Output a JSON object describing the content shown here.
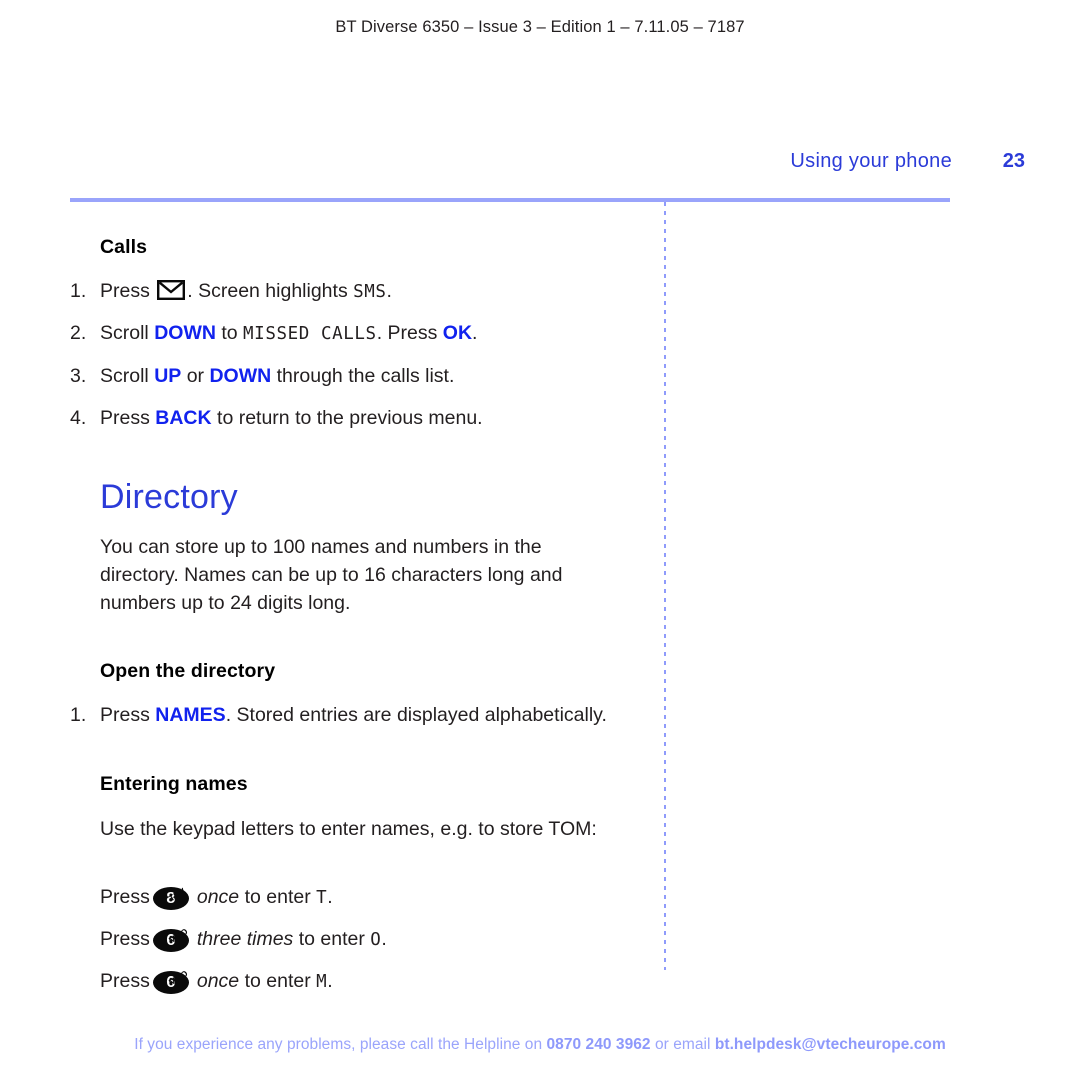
{
  "document": {
    "header_line": "BT Diverse 6350 – Issue 3 – Edition 1 – 7.11.05 – 7187"
  },
  "running_head": {
    "title": "Using your phone",
    "page_number": "23"
  },
  "colors": {
    "accent_blue": "#2b3bd8",
    "keyword_blue": "#1122ee",
    "rule_blue": "#9aa4fb",
    "footer_blue": "#9aa4fb",
    "body_black": "#231f20"
  },
  "sections": {
    "calls": {
      "heading": "Calls",
      "steps": [
        {
          "number": "1.",
          "before_icon": "Press ",
          "icon": "envelope-icon",
          "after_icon": ". Screen highlights ",
          "lcd": "SMS",
          "tail": "."
        },
        {
          "number": "2.",
          "part1": "Scroll ",
          "kw1": "DOWN",
          "part2": " to ",
          "lcd": "MISSED CALLS",
          "part3": ". Press ",
          "kw2": "OK",
          "tail": "."
        },
        {
          "number": "3.",
          "part1": "Scroll ",
          "kw1": "UP",
          "part2": " or ",
          "kw2": "DOWN",
          "part3": " through the calls list."
        },
        {
          "number": "4.",
          "part1": "Press ",
          "kw1": "BACK",
          "part2": " to return to the previous menu."
        }
      ]
    },
    "directory": {
      "heading": "Directory",
      "intro": "You can store up to 100 names and numbers in the directory. Names can be up to 16 characters long and numbers up to 24 digits long."
    },
    "open_directory": {
      "heading": "Open the directory",
      "step": {
        "number": "1.",
        "part1": "Press ",
        "kw1": "NAMES",
        "part2": ". Stored entries are displayed alphabetically."
      }
    },
    "entering_names": {
      "heading": "Entering names",
      "intro": "Use the keypad letters to enter names, e.g. to store TOM:",
      "presses": [
        {
          "lead": "Press",
          "key_digit": "8",
          "key_letters": "TUV",
          "emphasis": "once",
          "mid": " to enter ",
          "lcd": "T",
          "tail": "."
        },
        {
          "lead": "Press",
          "key_digit": "6",
          "key_letters": "MNO",
          "emphasis": "three times",
          "mid": " to enter ",
          "lcd": "O",
          "tail": "."
        },
        {
          "lead": "Press",
          "key_digit": "6",
          "key_letters": "MNO",
          "emphasis": "once",
          "mid": " to enter ",
          "lcd": "M",
          "tail": "."
        }
      ]
    }
  },
  "footer": {
    "part1": "If you experience any problems, please call the Helpline on ",
    "phone": "0870 240 3962",
    "part2": " or email ",
    "email": "bt.helpdesk@vtecheurope.com"
  }
}
